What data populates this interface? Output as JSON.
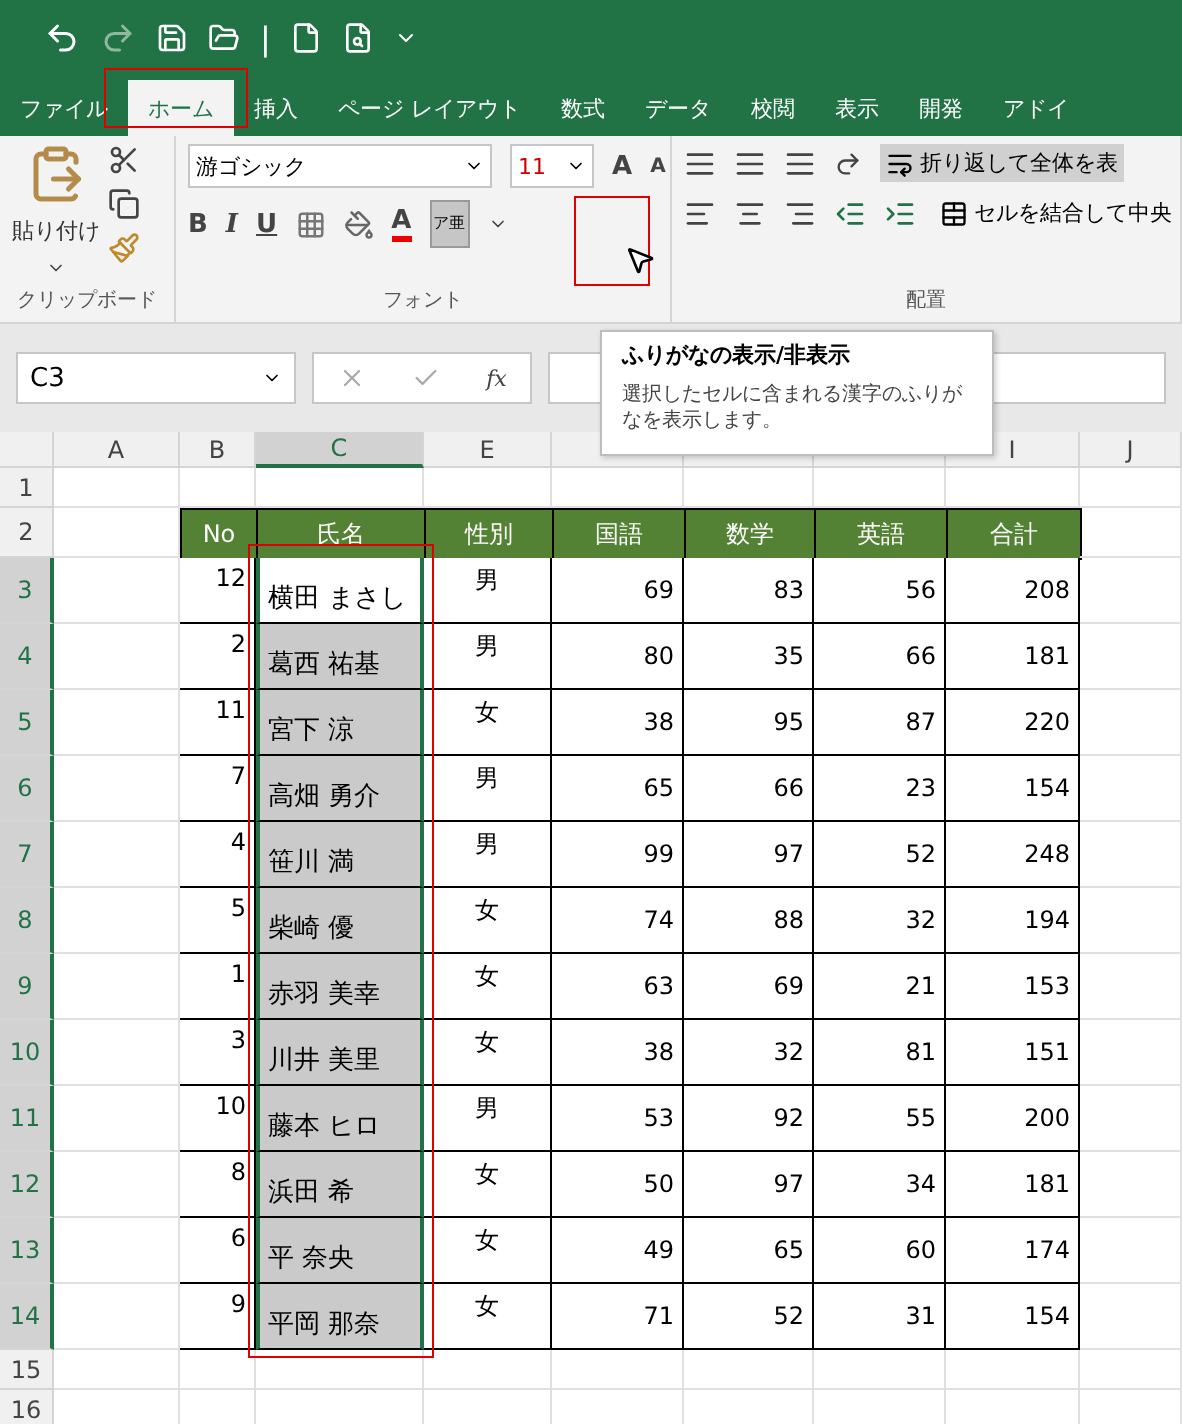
{
  "quick_access": {
    "separator": "|"
  },
  "tabs": [
    {
      "label": "ファイル",
      "selected": false
    },
    {
      "label": "ホーム",
      "selected": true
    },
    {
      "label": "挿入",
      "selected": false
    },
    {
      "label": "ページ レイアウト",
      "selected": false
    },
    {
      "label": "数式",
      "selected": false
    },
    {
      "label": "データ",
      "selected": false
    },
    {
      "label": "校閲",
      "selected": false
    },
    {
      "label": "表示",
      "selected": false
    },
    {
      "label": "開発",
      "selected": false
    },
    {
      "label": "アドイ",
      "selected": false
    }
  ],
  "ribbon": {
    "clipboard": {
      "paste": "貼り付け",
      "group": "クリップボード"
    },
    "font": {
      "name": "游ゴシック",
      "size": "11",
      "grow": "A",
      "shrink": "A",
      "bold": "B",
      "italic": "I",
      "underline": "U",
      "font_color": "A",
      "furigana": "ア亜",
      "group": "フォント"
    },
    "alignment": {
      "wrap": "折り返して全体を表",
      "merge": "セルを結合して中央",
      "group": "配置"
    }
  },
  "formula_bar": {
    "name_box": "C3",
    "fx": "fx"
  },
  "tooltip": {
    "title": "ふりがなの表示/非表示",
    "body": "選択したセルに含まれる漢字のふりがなを表示します。"
  },
  "columns": [
    "A",
    "B",
    "C",
    "E",
    "",
    "",
    "",
    "I",
    "J"
  ],
  "row_numbers": [
    "1",
    "2",
    "3",
    "4",
    "5",
    "6",
    "7",
    "8",
    "9",
    "10",
    "11",
    "12",
    "13",
    "14",
    "15",
    "16"
  ],
  "table": {
    "headers": [
      "No",
      "氏名",
      "性別",
      "国語",
      "数学",
      "英語",
      "合計"
    ],
    "rows": [
      {
        "no": "12",
        "name": "横田 まさし",
        "gender": "男",
        "scores": [
          "69",
          "83",
          "56"
        ],
        "total": "208",
        "selected": true,
        "active": true
      },
      {
        "no": "2",
        "name": "葛西 祐基",
        "gender": "男",
        "scores": [
          "80",
          "35",
          "66"
        ],
        "total": "181",
        "selected": true,
        "active": false
      },
      {
        "no": "11",
        "name": "宮下 涼",
        "gender": "女",
        "scores": [
          "38",
          "95",
          "87"
        ],
        "total": "220",
        "selected": true,
        "active": false
      },
      {
        "no": "7",
        "name": "高畑 勇介",
        "gender": "男",
        "scores": [
          "65",
          "66",
          "23"
        ],
        "total": "154",
        "selected": true,
        "active": false
      },
      {
        "no": "4",
        "name": "笹川 満",
        "gender": "男",
        "scores": [
          "99",
          "97",
          "52"
        ],
        "total": "248",
        "selected": true,
        "active": false
      },
      {
        "no": "5",
        "name": "柴崎 優",
        "gender": "女",
        "scores": [
          "74",
          "88",
          "32"
        ],
        "total": "194",
        "selected": true,
        "active": false
      },
      {
        "no": "1",
        "name": "赤羽 美幸",
        "gender": "女",
        "scores": [
          "63",
          "69",
          "21"
        ],
        "total": "153",
        "selected": true,
        "active": false
      },
      {
        "no": "3",
        "name": "川井 美里",
        "gender": "女",
        "scores": [
          "38",
          "32",
          "81"
        ],
        "total": "151",
        "selected": true,
        "active": false
      },
      {
        "no": "10",
        "name": "藤本 ヒロ",
        "gender": "男",
        "scores": [
          "53",
          "92",
          "55"
        ],
        "total": "200",
        "selected": true,
        "active": false
      },
      {
        "no": "8",
        "name": "浜田 希",
        "gender": "女",
        "scores": [
          "50",
          "97",
          "34"
        ],
        "total": "181",
        "selected": true,
        "active": false
      },
      {
        "no": "6",
        "name": "平 奈央",
        "gender": "女",
        "scores": [
          "49",
          "65",
          "60"
        ],
        "total": "174",
        "selected": true,
        "active": false
      },
      {
        "no": "9",
        "name": "平岡 那奈",
        "gender": "女",
        "scores": [
          "71",
          "52",
          "31"
        ],
        "total": "154",
        "selected": true,
        "active": false
      }
    ]
  }
}
